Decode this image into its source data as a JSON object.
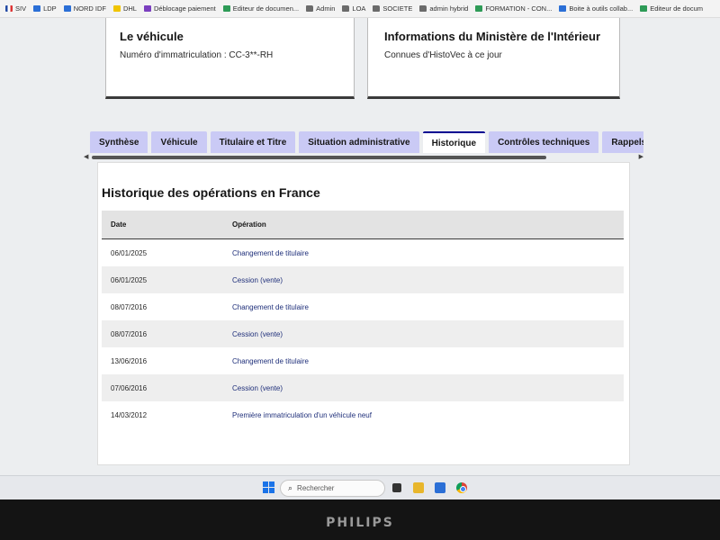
{
  "bookmarks": [
    {
      "label": "SIV",
      "icon": "flag-icon"
    },
    {
      "label": "LDP",
      "icon": "bookmark-icon"
    },
    {
      "label": "NORD IDF",
      "icon": "bookmark-icon"
    },
    {
      "label": "DHL",
      "icon": "folder-icon"
    },
    {
      "label": "Déblocage paiement",
      "icon": "bookmark-icon"
    },
    {
      "label": "Editeur de documen...",
      "icon": "bookmark-icon"
    },
    {
      "label": "Admin",
      "icon": "folder-icon"
    },
    {
      "label": "LOA",
      "icon": "folder-icon"
    },
    {
      "label": "SOCIETE",
      "icon": "folder-icon"
    },
    {
      "label": "admin hybrid",
      "icon": "folder-icon"
    },
    {
      "label": "FORMATION - CON...",
      "icon": "bookmark-icon"
    },
    {
      "label": "Boite à outils collab...",
      "icon": "bookmark-icon"
    },
    {
      "label": "Editeur de docum",
      "icon": "bookmark-icon"
    }
  ],
  "vehicle_card": {
    "title": "Le véhicule",
    "plate_line": "Numéro d'immatriculation : CC-3**-RH"
  },
  "ministry_card": {
    "title": "Informations du Ministère de l'Intérieur",
    "subtitle": "Connues d'HistoVec à ce jour"
  },
  "tabs": [
    {
      "label": "Synthèse",
      "active": false
    },
    {
      "label": "Véhicule",
      "active": false
    },
    {
      "label": "Titulaire et Titre",
      "active": false
    },
    {
      "label": "Situation administrative",
      "active": false
    },
    {
      "label": "Historique",
      "active": true
    },
    {
      "label": "Contrôles techniques",
      "active": false
    },
    {
      "label": "Rappels constru",
      "active": false
    }
  ],
  "history": {
    "title": "Historique des opérations en France",
    "columns": {
      "date": "Date",
      "operation": "Opération"
    },
    "rows": [
      {
        "date": "06/01/2025",
        "operation": "Changement de titulaire"
      },
      {
        "date": "06/01/2025",
        "operation": "Cession (vente)"
      },
      {
        "date": "08/07/2016",
        "operation": "Changement de titulaire"
      },
      {
        "date": "08/07/2016",
        "operation": "Cession (vente)"
      },
      {
        "date": "13/06/2016",
        "operation": "Changement de titulaire"
      },
      {
        "date": "07/06/2016",
        "operation": "Cession (vente)"
      },
      {
        "date": "14/03/2012",
        "operation": "Première immatriculation d'un véhicule neuf"
      }
    ]
  },
  "taskbar": {
    "search_placeholder": "Rechercher"
  },
  "monitor": {
    "brand": "PHILIPS"
  },
  "colors": {
    "tab_bg": "#cacaf5",
    "tab_active_border": "#000091",
    "operation_text": "#1f2f7a"
  }
}
